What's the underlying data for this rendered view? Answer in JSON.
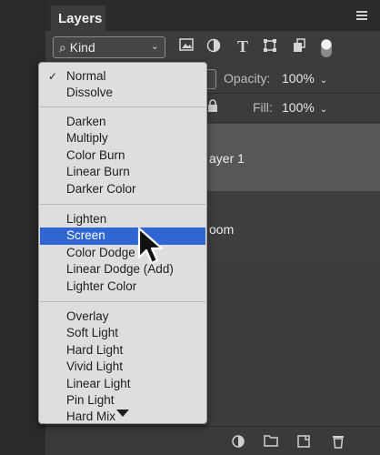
{
  "panel": {
    "tab_label": "Layers",
    "kind_filter": {
      "label": "Kind",
      "icon": "search-icon"
    },
    "filter_icons": [
      "image-filter-icon",
      "adjustment-filter-icon",
      "text-filter-icon",
      "shape-filter-icon",
      "smart-object-filter-icon",
      "filter-toggle-icon"
    ],
    "opacity": {
      "label": "Opacity:",
      "value": "100%"
    },
    "fill": {
      "label": "Fill:",
      "value": "100%"
    },
    "layers": [
      {
        "name": "ayer 1",
        "selected": true
      },
      {
        "name": "oom",
        "selected": false
      }
    ],
    "bottom_icons": [
      "adjustment-layer-icon",
      "group-folder-icon",
      "new-layer-icon",
      "trash-icon"
    ]
  },
  "blend_menu": {
    "groups": [
      [
        {
          "label": "Normal",
          "checked": true
        },
        {
          "label": "Dissolve"
        }
      ],
      [
        {
          "label": "Darken"
        },
        {
          "label": "Multiply"
        },
        {
          "label": "Color Burn"
        },
        {
          "label": "Linear Burn"
        },
        {
          "label": "Darker Color"
        }
      ],
      [
        {
          "label": "Lighten"
        },
        {
          "label": "Screen",
          "highlighted": true
        },
        {
          "label": "Color Dodge"
        },
        {
          "label": "Linear Dodge (Add)"
        },
        {
          "label": "Lighter Color"
        }
      ],
      [
        {
          "label": "Overlay"
        },
        {
          "label": "Soft Light"
        },
        {
          "label": "Hard Light"
        },
        {
          "label": "Vivid Light"
        },
        {
          "label": "Linear Light"
        },
        {
          "label": "Pin Light"
        },
        {
          "label": "Hard Mix"
        }
      ]
    ],
    "highlight_color": "#2f66d2",
    "check_glyph": "✓"
  }
}
